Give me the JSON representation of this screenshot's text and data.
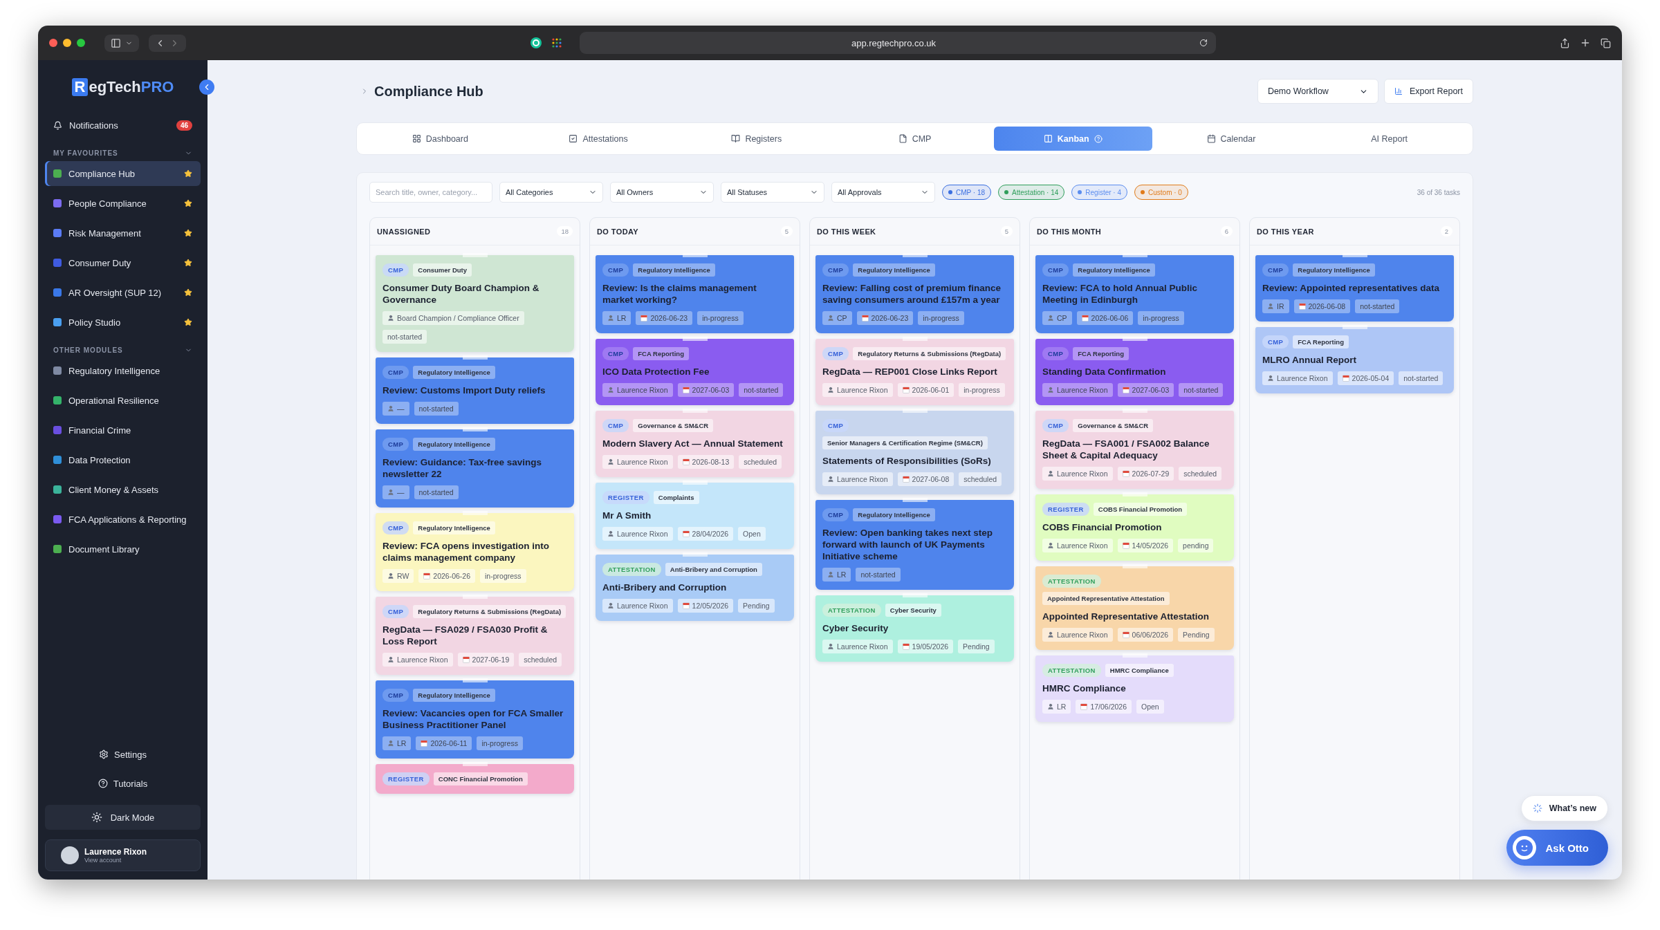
{
  "browser": {
    "url": "app.regtechpro.co.uk"
  },
  "sidebar": {
    "logo": {
      "mark": "R",
      "text": "egTech",
      "accent": "PRO"
    },
    "notifications": {
      "label": "Notifications",
      "badge": "46"
    },
    "favourites": {
      "heading": "MY FAVOURITES",
      "items": [
        {
          "label": "Compliance Hub",
          "color": "#4caf50",
          "selected": true,
          "starred": true
        },
        {
          "label": "People Compliance",
          "color": "#7c6cf0",
          "selected": false,
          "starred": true
        },
        {
          "label": "Risk Management",
          "color": "#5b7cf5",
          "selected": false,
          "starred": true
        },
        {
          "label": "Consumer Duty",
          "color": "#3f5be0",
          "selected": false,
          "starred": true
        },
        {
          "label": "AR Oversight (SUP 12)",
          "color": "#3a78e8",
          "selected": false,
          "starred": true
        },
        {
          "label": "Policy Studio",
          "color": "#4a9ff0",
          "selected": false,
          "starred": true
        }
      ]
    },
    "modules": {
      "heading": "OTHER MODULES",
      "items": [
        {
          "label": "Regulatory Intelligence",
          "color": "#7f8aa3",
          "selected": false
        },
        {
          "label": "Operational Resilience",
          "color": "#34b36a",
          "selected": false
        },
        {
          "label": "Financial Crime",
          "color": "#6a4fe0",
          "selected": false
        },
        {
          "label": "Data Protection",
          "color": "#2f8fd8",
          "selected": false
        },
        {
          "label": "Client Money & Assets",
          "color": "#3bb39a",
          "selected": false
        },
        {
          "label": "FCA Applications & Reporting",
          "color": "#7a5af0",
          "selected": false
        },
        {
          "label": "Document Library",
          "color": "#4caf50",
          "selected": false
        }
      ]
    },
    "footer_links": [
      {
        "kind": "settings",
        "label": "Settings"
      },
      {
        "kind": "help",
        "label": "Tutorials"
      }
    ],
    "theme_button": "Dark Mode",
    "account": {
      "name": "Laurence Rixon",
      "subtitle": "View account"
    }
  },
  "header": {
    "title": "Compliance Hub",
    "workflow_select": "Demo Workflow",
    "export_button": "Export Report"
  },
  "tabs": [
    {
      "label": "Dashboard",
      "kind": "grid",
      "selected": false,
      "help": false
    },
    {
      "label": "Attestations",
      "kind": "check",
      "selected": false,
      "help": false
    },
    {
      "label": "Registers",
      "kind": "book",
      "selected": false,
      "help": false
    },
    {
      "label": "CMP",
      "kind": "file",
      "selected": false,
      "help": false
    },
    {
      "label": "Kanban",
      "kind": "kanban",
      "selected": true,
      "help": true
    },
    {
      "label": "Calendar",
      "kind": "calendar",
      "selected": false,
      "help": false
    },
    {
      "label": "AI Report",
      "kind": "text",
      "selected": false,
      "help": false
    }
  ],
  "filters": {
    "search_placeholder": "Search title, owner, category...",
    "selects": [
      "All Categories",
      "All Owners",
      "All Statuses",
      "All Approvals"
    ],
    "chips": [
      {
        "label": "CMP · 18",
        "color": "#3b6fe0"
      },
      {
        "label": "Attestation · 14",
        "color": "#2f9e5b"
      },
      {
        "label": "Register · 4",
        "color": "#5b8def"
      },
      {
        "label": "Custom · 0",
        "color": "#e07b1a"
      }
    ],
    "count": "36 of 36 tasks"
  },
  "columns": [
    {
      "title": "UNASSIGNED",
      "count": "18",
      "cards": [
        {
          "color": "#cfe6d3",
          "strong": false,
          "type": {
            "kind": "cmp",
            "label": "CMP"
          },
          "category": "Consumer Duty",
          "title": "Consumer Duty Board Champion & Governance",
          "owner": "Board Champion / Compliance Officer",
          "status": "not-started"
        },
        {
          "color": "#4f84ec",
          "strong": true,
          "type": {
            "kind": "cmp",
            "label": "CMP"
          },
          "category": "Regulatory Intelligence",
          "title": "Review: Customs Import Duty reliefs",
          "owner": "—",
          "status": "not-started"
        },
        {
          "color": "#4f84ec",
          "strong": true,
          "type": {
            "kind": "cmp",
            "label": "CMP"
          },
          "category": "Regulatory Intelligence",
          "title": "Review: Guidance: Tax-free savings newsletter 22",
          "owner": "—",
          "status": "not-started"
        },
        {
          "color": "#fbf6bf",
          "strong": false,
          "type": {
            "kind": "cmp",
            "label": "CMP"
          },
          "category": "Regulatory Intelligence",
          "title": "Review: FCA opens investigation into claims management company",
          "owner": "RW",
          "date": "2026-06-26",
          "status": "in-progress"
        },
        {
          "color": "#f2d6e3",
          "strong": false,
          "type": {
            "kind": "cmp",
            "label": "CMP"
          },
          "category": "Regulatory Returns & Submissions (RegData)",
          "title": "RegData — FSA029 / FSA030 Profit & Loss Report",
          "owner": "Laurence Rixon",
          "date": "2027-06-19",
          "status": "scheduled"
        },
        {
          "color": "#4f84ec",
          "strong": true,
          "type": {
            "kind": "cmp",
            "label": "CMP"
          },
          "category": "Regulatory Intelligence",
          "title": "Review: Vacancies open for FCA Smaller Business Practitioner Panel",
          "owner": "LR",
          "date": "2026-06-11",
          "status": "in-progress"
        },
        {
          "color": "#f3aacb",
          "strong": false,
          "type": {
            "kind": "register",
            "label": "REGISTER"
          },
          "category": "CONC Financial Promotion"
        }
      ]
    },
    {
      "title": "DO TODAY",
      "count": "5",
      "cards": [
        {
          "color": "#4f84ec",
          "strong": true,
          "type": {
            "kind": "cmp",
            "label": "CMP"
          },
          "category": "Regulatory Intelligence",
          "title": "Review: Is the claims management market working?",
          "owner": "LR",
          "date": "2026-06-23",
          "status": "in-progress"
        },
        {
          "color": "#8a5cf0",
          "strong": true,
          "type": {
            "kind": "cmp",
            "label": "CMP"
          },
          "category": "FCA Reporting",
          "title": "ICO Data Protection Fee",
          "owner": "Laurence Rixon",
          "date": "2027-06-03",
          "status": "not-started"
        },
        {
          "color": "#f2d6e3",
          "strong": false,
          "type": {
            "kind": "cmp",
            "label": "CMP"
          },
          "category": "Governance & SM&CR",
          "title": "Modern Slavery Act — Annual Statement",
          "owner": "Laurence Rixon",
          "date": "2026-08-13",
          "status": "scheduled"
        },
        {
          "color": "#c4e6fa",
          "strong": false,
          "type": {
            "kind": "register",
            "label": "REGISTER"
          },
          "category": "Complaints",
          "title": "Mr A Smith",
          "owner": "Laurence Rixon",
          "date": "28/04/2026",
          "status": "Open"
        },
        {
          "color": "#a9cbf6",
          "strong": false,
          "type": {
            "kind": "attestation",
            "label": "ATTESTATION"
          },
          "category": "Anti-Bribery and Corruption",
          "title": "Anti-Bribery and Corruption",
          "owner": "Laurence Rixon",
          "date": "12/05/2026",
          "status": "Pending"
        }
      ]
    },
    {
      "title": "DO THIS WEEK",
      "count": "5",
      "cards": [
        {
          "color": "#4f84ec",
          "strong": true,
          "type": {
            "kind": "cmp",
            "label": "CMP"
          },
          "category": "Regulatory Intelligence",
          "title": "Review: Falling cost of premium finance saving consumers around £157m a year",
          "owner": "CP",
          "date": "2026-06-23",
          "status": "in-progress"
        },
        {
          "color": "#f2d6e3",
          "strong": false,
          "type": {
            "kind": "cmp",
            "label": "CMP"
          },
          "category": "Regulatory Returns & Submissions (RegData)",
          "title": "RegData — REP001 Close Links Report",
          "owner": "Laurence Rixon",
          "date": "2026-06-01",
          "status": "in-progress"
        },
        {
          "color": "#c8d6ee",
          "strong": false,
          "type": {
            "kind": "cmp",
            "label": "CMP"
          },
          "category": "Senior Managers & Certification Regime (SM&CR)",
          "title": "Statements of Responsibilities (SoRs)",
          "owner": "Laurence Rixon",
          "date": "2027-06-08",
          "status": "scheduled"
        },
        {
          "color": "#4f84ec",
          "strong": true,
          "type": {
            "kind": "cmp",
            "label": "CMP"
          },
          "category": "Regulatory Intelligence",
          "title": "Review: Open banking takes next step forward with launch of UK Payments Initiative scheme",
          "owner": "LR",
          "status": "not-started"
        },
        {
          "color": "#aef0df",
          "strong": false,
          "type": {
            "kind": "attestation",
            "label": "ATTESTATION"
          },
          "category": "Cyber Security",
          "title": "Cyber Security",
          "owner": "Laurence Rixon",
          "date": "19/05/2026",
          "status": "Pending"
        }
      ]
    },
    {
      "title": "DO THIS MONTH",
      "count": "6",
      "cards": [
        {
          "color": "#4f84ec",
          "strong": true,
          "type": {
            "kind": "cmp",
            "label": "CMP"
          },
          "category": "Regulatory Intelligence",
          "title": "Review: FCA to hold Annual Public Meeting in Edinburgh",
          "owner": "CP",
          "date": "2026-06-06",
          "status": "in-progress"
        },
        {
          "color": "#8a5cf0",
          "strong": true,
          "type": {
            "kind": "cmp",
            "label": "CMP"
          },
          "category": "FCA Reporting",
          "title": "Standing Data Confirmation",
          "owner": "Laurence Rixon",
          "date": "2027-06-03",
          "status": "not-started"
        },
        {
          "color": "#f2d6e3",
          "strong": false,
          "type": {
            "kind": "cmp",
            "label": "CMP"
          },
          "category": "Governance & SM&CR",
          "title": "RegData — FSA001 / FSA002 Balance Sheet & Capital Adequacy",
          "owner": "Laurence Rixon",
          "date": "2026-07-29",
          "status": "scheduled"
        },
        {
          "color": "#e0fcc0",
          "strong": false,
          "type": {
            "kind": "register",
            "label": "REGISTER"
          },
          "category": "COBS Financial Promotion",
          "title": "COBS Financial Promotion",
          "owner": "Laurence Rixon",
          "date": "14/05/2026",
          "status": "pending"
        },
        {
          "color": "#f8d6a9",
          "strong": false,
          "type": {
            "kind": "attestation",
            "label": "ATTESTATION"
          },
          "category": "Appointed Representative Attestation",
          "title": "Appointed Representative Attestation",
          "owner": "Laurence Rixon",
          "date": "06/06/2026",
          "status": "Pending"
        },
        {
          "color": "#e4dcfb",
          "strong": false,
          "type": {
            "kind": "attestation",
            "label": "ATTESTATION"
          },
          "category": "HMRC Compliance",
          "title": "HMRC Compliance",
          "owner": "LR",
          "date": "17/06/2026",
          "status": "Open"
        }
      ]
    },
    {
      "title": "DO THIS YEAR",
      "count": "2",
      "cards": [
        {
          "color": "#4f84ec",
          "strong": true,
          "type": {
            "kind": "cmp",
            "label": "CMP"
          },
          "category": "Regulatory Intelligence",
          "title": "Review: Appointed representatives data",
          "owner": "IR",
          "date": "2026-06-08",
          "status": "not-started"
        },
        {
          "color": "#aec6f6",
          "strong": false,
          "type": {
            "kind": "cmp",
            "label": "CMP"
          },
          "category": "FCA Reporting",
          "title": "MLRO Annual Report",
          "owner": "Laurence Rixon",
          "date": "2026-05-04",
          "status": "not-started"
        }
      ]
    }
  ],
  "whats_new": "What’s new",
  "assistant_button": "Ask Otto"
}
